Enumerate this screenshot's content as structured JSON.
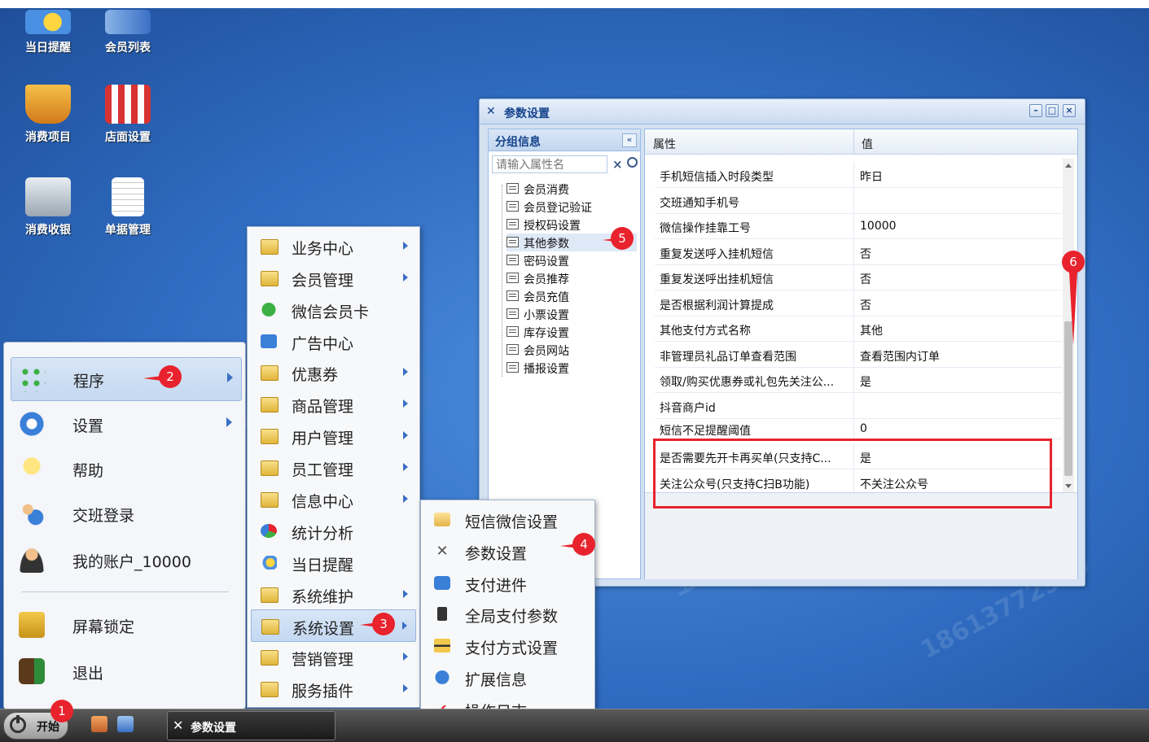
{
  "desktop": {
    "icons": [
      {
        "label": "当日提醒",
        "icon": "reminder-icon"
      },
      {
        "label": "会员列表",
        "icon": "member-list-icon"
      },
      {
        "label": "消费项目",
        "icon": "basket-icon"
      },
      {
        "label": "店面设置",
        "icon": "storefront-icon"
      },
      {
        "label": "消费收银",
        "icon": "cash-register-icon"
      },
      {
        "label": "单据管理",
        "icon": "notepad-icon"
      }
    ]
  },
  "start_menu": {
    "items": [
      {
        "label": "程序",
        "icon": "apps-grid-icon",
        "has_submenu": true
      },
      {
        "label": "设置",
        "icon": "gear-icon",
        "has_submenu": true
      },
      {
        "label": "帮助",
        "icon": "lightbulb-icon",
        "has_submenu": false
      },
      {
        "label": "交班登录",
        "icon": "users-icon",
        "has_submenu": false
      },
      {
        "label": "我的账户_10000",
        "icon": "user-icon",
        "has_submenu": false
      },
      {
        "label": "屏幕锁定",
        "icon": "lock-icon",
        "has_submenu": false
      },
      {
        "label": "退出",
        "icon": "exit-door-icon",
        "has_submenu": false
      }
    ]
  },
  "program_menu": {
    "items": [
      {
        "label": "业务中心",
        "has_submenu": true
      },
      {
        "label": "会员管理",
        "has_submenu": true
      },
      {
        "label": "微信会员卡",
        "has_submenu": false
      },
      {
        "label": "广告中心",
        "has_submenu": false
      },
      {
        "label": "优惠券",
        "has_submenu": true
      },
      {
        "label": "商品管理",
        "has_submenu": true
      },
      {
        "label": "用户管理",
        "has_submenu": true
      },
      {
        "label": "员工管理",
        "has_submenu": true
      },
      {
        "label": "信息中心",
        "has_submenu": true
      },
      {
        "label": "统计分析",
        "has_submenu": false
      },
      {
        "label": "当日提醒",
        "has_submenu": false
      },
      {
        "label": "系统维护",
        "has_submenu": true
      },
      {
        "label": "系统设置",
        "has_submenu": true
      },
      {
        "label": "营销管理",
        "has_submenu": true
      },
      {
        "label": "服务插件",
        "has_submenu": true
      }
    ]
  },
  "system_menu": {
    "items": [
      {
        "label": "短信微信设置",
        "icon": "sms-icon"
      },
      {
        "label": "参数设置",
        "icon": "tools-icon"
      },
      {
        "label": "支付进件",
        "icon": "payment-icon"
      },
      {
        "label": "全局支付参数",
        "icon": "phone-icon"
      },
      {
        "label": "支付方式设置",
        "icon": "card-icon"
      },
      {
        "label": "扩展信息",
        "icon": "extension-icon"
      },
      {
        "label": "操作日志",
        "icon": "checkmark-icon"
      }
    ]
  },
  "window": {
    "title": "参数设置",
    "left_panel": {
      "title": "分组信息",
      "collapse_label": "«",
      "search_placeholder": "请输入属性名",
      "clear_label": "×",
      "groups": [
        "会员消费",
        "会员登记验证",
        "授权码设置",
        "其他参数",
        "密码设置",
        "会员推荐",
        "会员充值",
        "小票设置",
        "库存设置",
        "会员网站",
        "播报设置"
      ],
      "selected_group": "其他参数"
    },
    "grid": {
      "columns": [
        "属性",
        "值"
      ],
      "rows": [
        {
          "key": "手机短信插入时段类型",
          "value": "昨日"
        },
        {
          "key": "交班通知手机号",
          "value": ""
        },
        {
          "key": "微信操作挂靠工号",
          "value": "10000"
        },
        {
          "key": "重复发送呼入挂机短信",
          "value": "否"
        },
        {
          "key": "重复发送呼出挂机短信",
          "value": "否"
        },
        {
          "key": "是否根据利润计算提成",
          "value": "否"
        },
        {
          "key": "其他支付方式名称",
          "value": "其他"
        },
        {
          "key": "非管理员礼品订单查看范围",
          "value": "查看范围内订单"
        },
        {
          "key": "领取/购买优惠券或礼包先关注公...",
          "value": "是"
        },
        {
          "key": "抖音商户id",
          "value": ""
        },
        {
          "key": "短信不足提醒阈值",
          "value": "0"
        },
        {
          "key": "是否需要先开卡再买单(只支持C...",
          "value": "是"
        },
        {
          "key": "关注公众号(只支持C扫B功能)",
          "value": "不关注公众号"
        }
      ]
    }
  },
  "taskbar": {
    "start_label": "开始",
    "task_label": "参数设置"
  },
  "callouts": [
    "1",
    "2",
    "3",
    "4",
    "5",
    "6"
  ],
  "colors": {
    "accent": "#15428b",
    "highlight": "#e8232d"
  }
}
